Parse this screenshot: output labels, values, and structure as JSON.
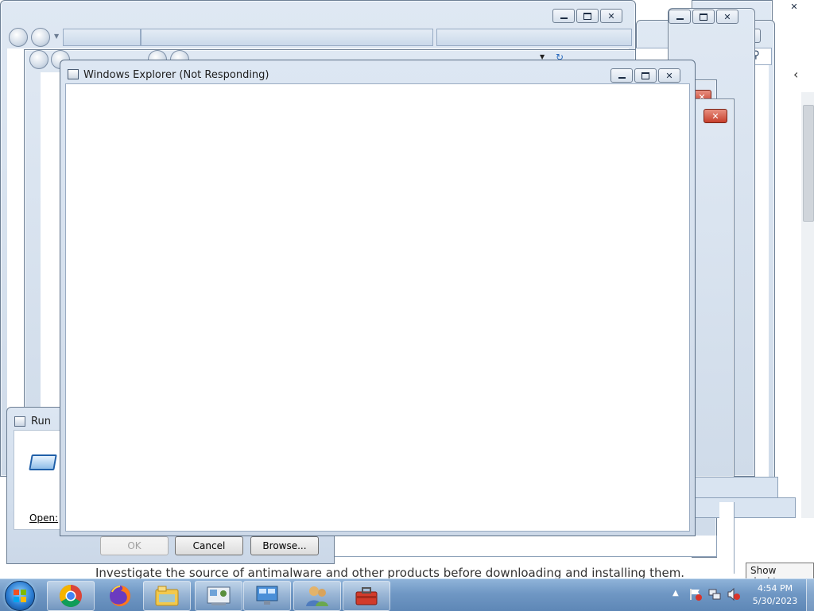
{
  "background_page": {
    "partial_text": "Investigate the source of antimalware and other products before downloading and installing them."
  },
  "explorer_window": {
    "title": "Windows Explorer (Not Responding)"
  },
  "run_dialog": {
    "title": "Run",
    "open_label": "Open:",
    "ok_label": "OK",
    "cancel_label": "Cancel",
    "browse_label": "Browse..."
  },
  "taskbar": {
    "apps": [
      "chrome-icon",
      "firefox-icon",
      "file-explorer-icon",
      "control-panel-icon",
      "remote-desktop-icon",
      "users-icon",
      "toolbox-icon"
    ],
    "clock_time": "4:54 PM",
    "clock_date": "5/30/2023",
    "show_desktop_tooltip": "Show desktop"
  },
  "colors": {
    "close_red": "#c7402d",
    "taskbar_blue": "#6f97c4"
  }
}
